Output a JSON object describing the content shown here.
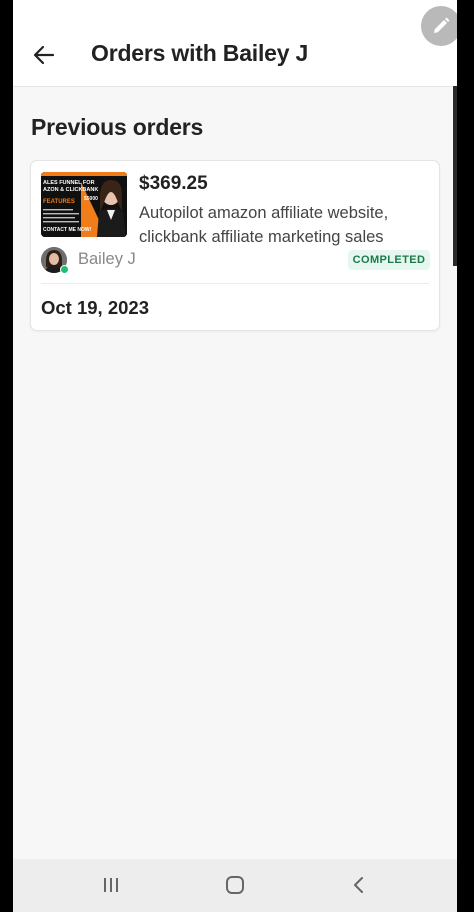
{
  "header": {
    "title": "Orders with Bailey J",
    "back_icon": "arrow-left-icon"
  },
  "fab": {
    "icon": "pencil-icon"
  },
  "section": {
    "title": "Previous orders"
  },
  "orders": [
    {
      "price": "$369.25",
      "description": "Autopilot amazon affiliate website, clickbank affiliate marketing sales",
      "thumbnail": {
        "lines": [
          "ALES FUNNEL FOR",
          "AZON & CLICKBANK",
          "FEATURES",
          "CONTACT ME NOW!"
        ],
        "badge": "$5000"
      },
      "seller": {
        "name": "Bailey J",
        "online": true
      },
      "status": "COMPLETED",
      "date": "Oct 19, 2023"
    }
  ],
  "nav": {
    "recents_icon": "recents-icon",
    "home_icon": "home-icon",
    "back_icon": "back-chevron-icon"
  },
  "colors": {
    "status_bg": "#e5f7ee",
    "status_text": "#1c7a4a",
    "online": "#1dbf73",
    "thumb_accent": "#f07d1a"
  }
}
